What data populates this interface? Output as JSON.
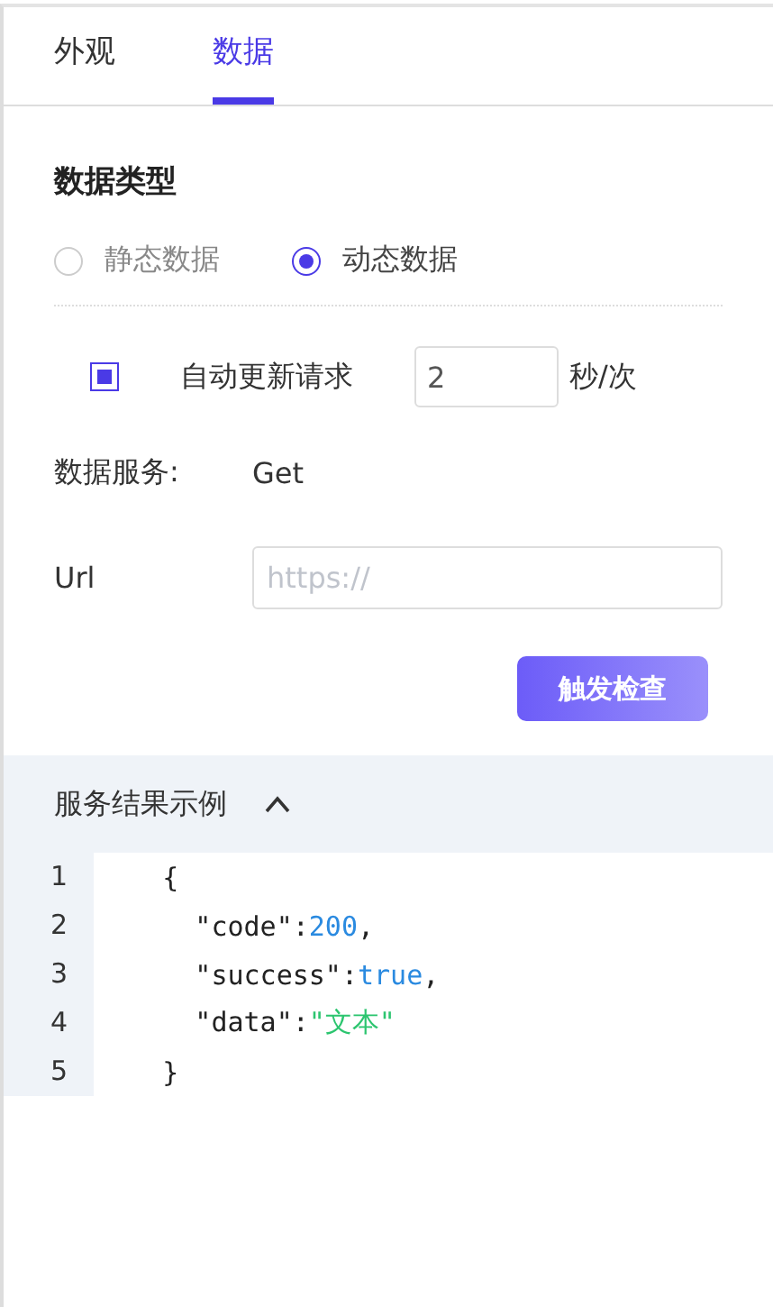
{
  "tabs": [
    {
      "label": "外观",
      "selected": false
    },
    {
      "label": "数据",
      "selected": true
    }
  ],
  "data_type": {
    "title": "数据类型",
    "options": [
      {
        "label": "静态数据",
        "selected": false
      },
      {
        "label": "动态数据",
        "selected": true
      }
    ]
  },
  "auto_update": {
    "label": "自动更新请求",
    "checked": true,
    "value": "2",
    "unit": "秒/次"
  },
  "service": {
    "label": "数据服务:",
    "value": "Get"
  },
  "url": {
    "label": "Url",
    "placeholder": "https://"
  },
  "check_button": "触发检查",
  "result": {
    "title": "服务结果示例",
    "expanded": true,
    "lines": [
      {
        "number": "1",
        "tokens": [
          {
            "kind": "plain",
            "text": "    {"
          }
        ]
      },
      {
        "number": "2",
        "tokens": [
          {
            "kind": "plain",
            "text": "      \"code\":"
          },
          {
            "kind": "number",
            "text": "200"
          },
          {
            "kind": "plain",
            "text": ","
          }
        ]
      },
      {
        "number": "3",
        "tokens": [
          {
            "kind": "plain",
            "text": "      \"success\":"
          },
          {
            "kind": "number",
            "text": "true"
          },
          {
            "kind": "plain",
            "text": ","
          }
        ]
      },
      {
        "number": "4",
        "tokens": [
          {
            "kind": "plain",
            "text": "      \"data\":"
          },
          {
            "kind": "string",
            "text": "\"文本\""
          }
        ]
      },
      {
        "number": "5",
        "tokens": [
          {
            "kind": "plain",
            "text": "    }"
          }
        ]
      }
    ]
  }
}
